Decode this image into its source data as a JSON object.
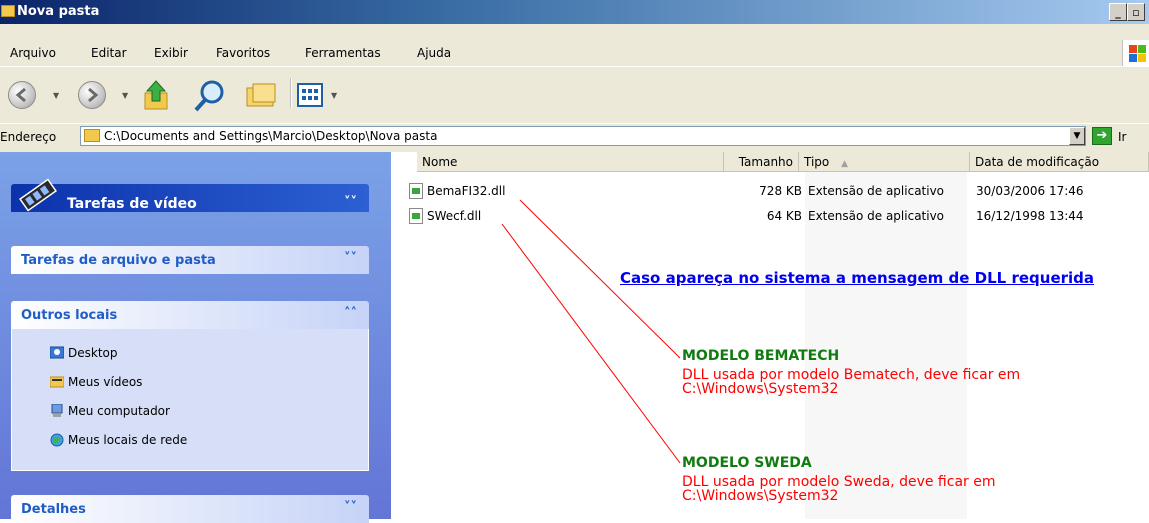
{
  "window": {
    "title": "Nova pasta"
  },
  "menu": [
    "Arquivo",
    "Editar",
    "Exibir",
    "Favoritos",
    "Ferramentas",
    "Ajuda"
  ],
  "address": {
    "label": "Endereço",
    "value": "C:\\Documents and Settings\\Marcio\\Desktop\\Nova pasta",
    "go_label": "Ir"
  },
  "taskpane": {
    "video_tasks": "Tarefas de vídeo",
    "file_tasks": "Tarefas de arquivo e pasta",
    "other_places": "Outros locais",
    "other_places_items": [
      "Desktop",
      "Meus vídeos",
      "Meu computador",
      "Meus locais de rede"
    ],
    "details": "Detalhes"
  },
  "columns": {
    "name": "Nome",
    "size": "Tamanho",
    "type": "Tipo",
    "modified": "Data de modificação"
  },
  "files": [
    {
      "name": "BemaFI32.dll",
      "size": "728 KB",
      "type": "Extensão de aplicativo",
      "modified": "30/03/2006 17:46"
    },
    {
      "name": "SWecf.dll",
      "size": "64 KB",
      "type": "Extensão de aplicativo",
      "modified": "16/12/1998 13:44"
    }
  ],
  "annotations": {
    "headline": "Caso apareça no sistema a mensagem de DLL requerida",
    "bematech_title": "MODELO BEMATECH",
    "bematech_line1": "DLL usada por modelo Bematech, deve ficar em",
    "bematech_line2": "C:\\Windows\\System32",
    "sweda_title": "MODELO SWEDA",
    "sweda_line1": "DLL usada por modelo Sweda, deve ficar em",
    "sweda_line2": "C:\\Windows\\System32"
  },
  "icons": [
    "folder-icon",
    "back-icon",
    "forward-icon",
    "up-folder-icon",
    "search-icon",
    "folders-icon",
    "views-icon",
    "go-arrow-icon",
    "film-icon",
    "desktop-icon",
    "videos-icon",
    "computer-icon",
    "network-icon",
    "dll-file-icon",
    "windows-flag-icon"
  ],
  "colors": {
    "annotation_title": "#107c10",
    "annotation_text": "#ff0000",
    "link": "#0000ee",
    "taskpane_blue": "#6375d6"
  }
}
